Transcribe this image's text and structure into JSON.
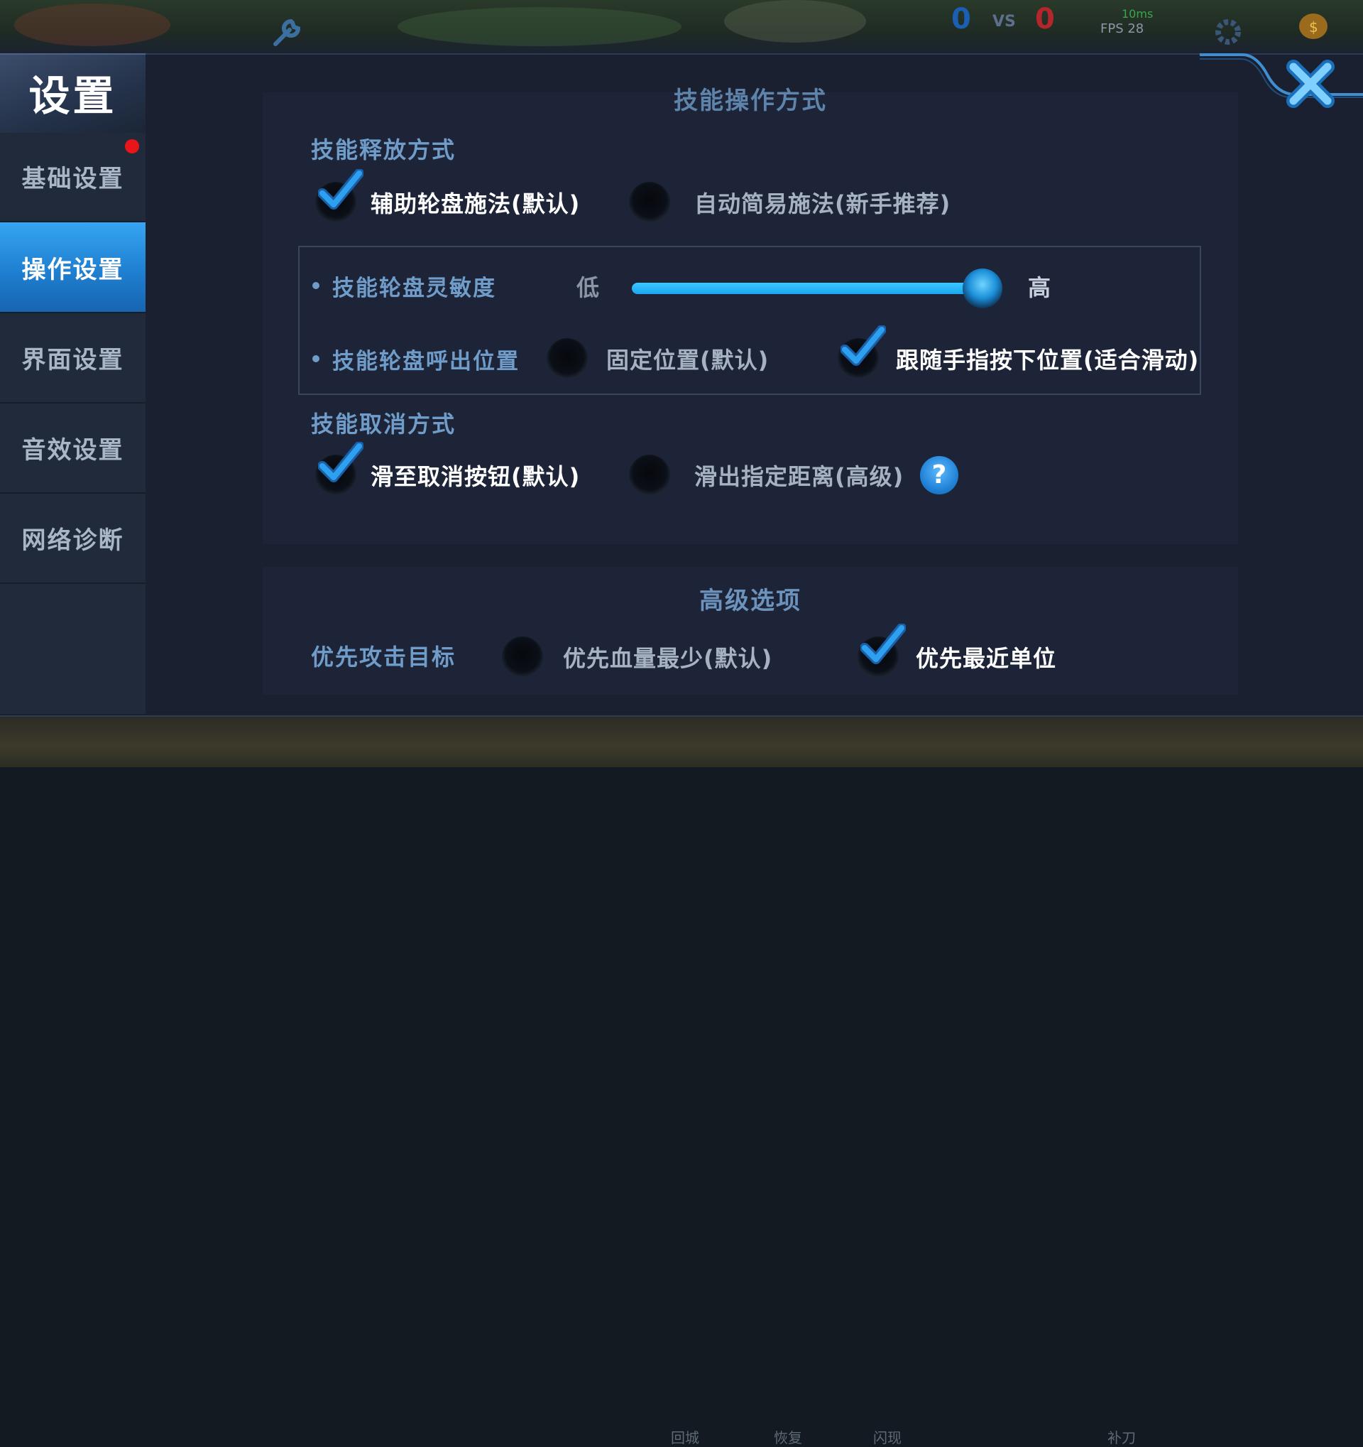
{
  "hud": {
    "score_left": "0",
    "vs": "VS",
    "score_right": "0",
    "fps": "FPS 28",
    "ping": "10ms",
    "colors": {
      "score_left": "#1b5fb3",
      "score_right": "#b3262b"
    }
  },
  "settings": {
    "title": "设置",
    "nav": [
      {
        "label": "基础设置",
        "active": false,
        "has_badge": true
      },
      {
        "label": "操作设置",
        "active": true,
        "has_badge": false
      },
      {
        "label": "界面设置",
        "active": false,
        "has_badge": false
      },
      {
        "label": "音效设置",
        "active": false,
        "has_badge": false
      },
      {
        "label": "网络诊断",
        "active": false,
        "has_badge": false
      }
    ],
    "close_icon": "close-x-icon"
  },
  "skill_panel": {
    "header": "技能操作方式",
    "release": {
      "label": "技能释放方式",
      "options": [
        {
          "label": "辅助轮盘施法(默认)",
          "selected": true
        },
        {
          "label": "自动简易施法(新手推荐)",
          "selected": false
        }
      ]
    },
    "sensitivity": {
      "label": "技能轮盘灵敏度",
      "low": "低",
      "high": "高",
      "value": 0.95
    },
    "position": {
      "label": "技能轮盘呼出位置",
      "options": [
        {
          "label": "固定位置(默认)",
          "selected": false
        },
        {
          "label": "跟随手指按下位置(适合滑动)",
          "selected": true
        }
      ]
    },
    "cancel": {
      "label": "技能取消方式",
      "options": [
        {
          "label": "滑至取消按钮(默认)",
          "selected": true
        },
        {
          "label": "滑出指定距离(高级)",
          "selected": false
        }
      ],
      "help": "?"
    }
  },
  "advanced_panel": {
    "header": "高级选项",
    "target": {
      "label": "优先攻击目标",
      "options": [
        {
          "label": "优先血量最少(默认)",
          "selected": false
        },
        {
          "label": "优先最近单位",
          "selected": true
        }
      ]
    }
  },
  "bottom_bar": {
    "skills": [
      "回城",
      "恢复",
      "闪现",
      "补刀"
    ]
  }
}
